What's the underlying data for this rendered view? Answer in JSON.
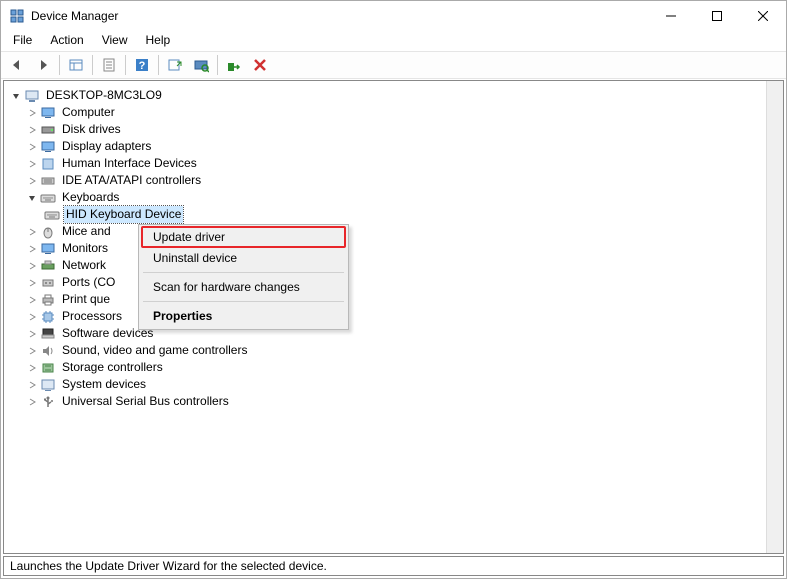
{
  "window": {
    "title": "Device Manager"
  },
  "menubar": {
    "items": [
      "File",
      "Action",
      "View",
      "Help"
    ]
  },
  "tree": {
    "root": "DESKTOP-8MC3LO9",
    "children": [
      {
        "label": "Computer",
        "icon": "monitor"
      },
      {
        "label": "Disk drives",
        "icon": "disk"
      },
      {
        "label": "Display adapters",
        "icon": "monitor"
      },
      {
        "label": "Human Interface Devices",
        "icon": "hid"
      },
      {
        "label": "IDE ATA/ATAPI controllers",
        "icon": "ide"
      },
      {
        "label": "Keyboards",
        "icon": "keyboard",
        "expanded": true,
        "children": [
          {
            "label": "HID Keyboard Device",
            "icon": "keyboard",
            "selected": true
          }
        ]
      },
      {
        "label": "Mice and",
        "icon": "mouse",
        "truncated": true
      },
      {
        "label": "Monitors",
        "icon": "monitor",
        "truncated": true
      },
      {
        "label": "Network",
        "icon": "network",
        "truncated": true
      },
      {
        "label": "Ports (CO",
        "icon": "ports",
        "truncated": true
      },
      {
        "label": "Print que",
        "icon": "printer",
        "truncated": true
      },
      {
        "label": "Processors",
        "icon": "cpu"
      },
      {
        "label": "Software devices",
        "icon": "software"
      },
      {
        "label": "Sound, video and game controllers",
        "icon": "sound"
      },
      {
        "label": "Storage controllers",
        "icon": "storage"
      },
      {
        "label": "System devices",
        "icon": "system"
      },
      {
        "label": "Universal Serial Bus controllers",
        "icon": "usb"
      }
    ]
  },
  "context_menu": {
    "items": [
      {
        "label": "Update driver",
        "highlighted": true
      },
      {
        "label": "Uninstall device"
      },
      {
        "separator": true
      },
      {
        "label": "Scan for hardware changes"
      },
      {
        "separator": true
      },
      {
        "label": "Properties",
        "bold": true
      }
    ]
  },
  "statusbar": {
    "text": "Launches the Update Driver Wizard for the selected device."
  }
}
